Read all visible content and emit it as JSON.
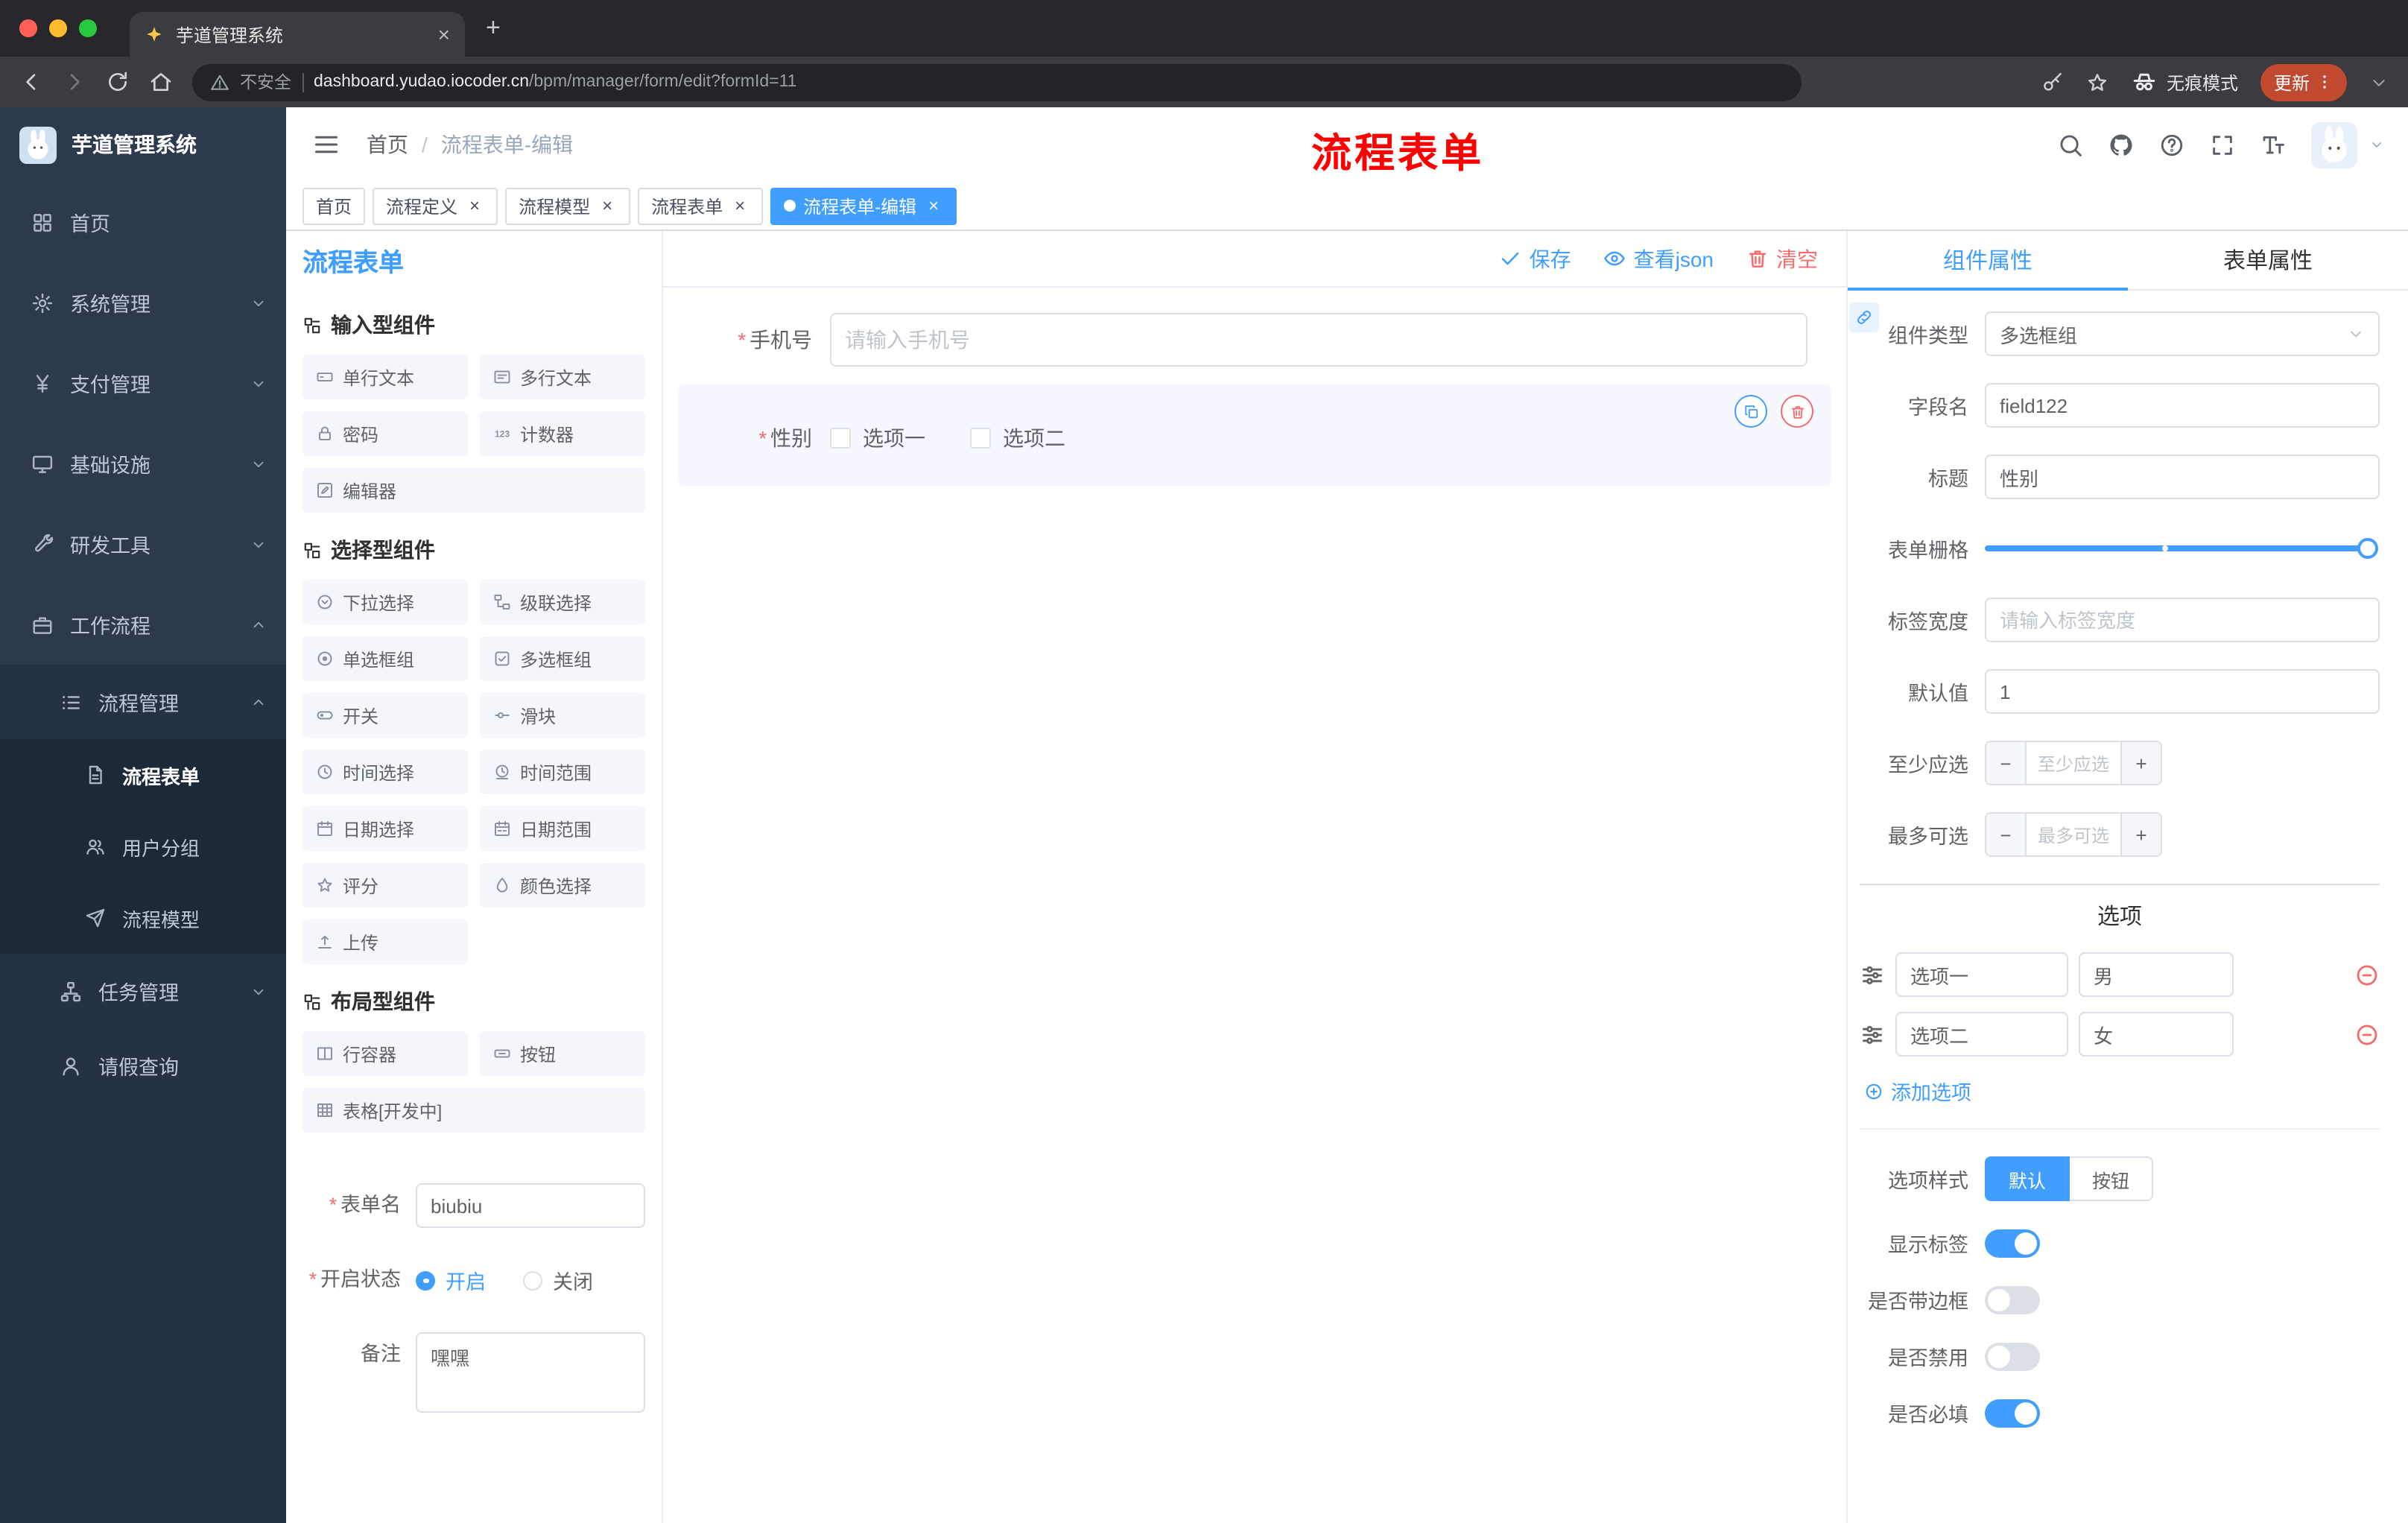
{
  "browser": {
    "tab_title": "芋道管理系统",
    "security_label": "不安全",
    "url_host": "dashboard.yudao.iocoder.cn",
    "url_path": "/bpm/manager/form/edit?formId=11",
    "incognito_label": "无痕模式",
    "update_label": "更新"
  },
  "sidebar": {
    "logo_title": "芋道管理系统",
    "items": [
      {
        "label": "首页"
      },
      {
        "label": "系统管理"
      },
      {
        "label": "支付管理"
      },
      {
        "label": "基础设施"
      },
      {
        "label": "研发工具"
      },
      {
        "label": "工作流程"
      }
    ],
    "process_group": "流程管理",
    "process_children": [
      {
        "label": "流程表单"
      },
      {
        "label": "用户分组"
      },
      {
        "label": "流程模型"
      }
    ],
    "task_group": "任务管理",
    "leave_query": "请假查询"
  },
  "header": {
    "breadcrumb_home": "首页",
    "breadcrumb_sep": "/",
    "breadcrumb_current": "流程表单-编辑",
    "annotation": "流程表单"
  },
  "tags": [
    {
      "label": "首页"
    },
    {
      "label": "流程定义"
    },
    {
      "label": "流程模型"
    },
    {
      "label": "流程表单"
    },
    {
      "label": "流程表单-编辑"
    }
  ],
  "designer": {
    "brand": "流程表单",
    "toolbar": {
      "save": "保存",
      "view_json": "查看json",
      "clear": "清空"
    },
    "palette": {
      "input_title": "输入型组件",
      "input_items": [
        "单行文本",
        "多行文本",
        "密码",
        "计数器",
        "编辑器"
      ],
      "select_title": "选择型组件",
      "select_items": [
        "下拉选择",
        "级联选择",
        "单选框组",
        "多选框组",
        "开关",
        "滑块",
        "时间选择",
        "时间范围",
        "日期选择",
        "日期范围",
        "评分",
        "颜色选择",
        "上传"
      ],
      "layout_title": "布局型组件",
      "layout_items": [
        "行容器",
        "按钮",
        "表格[开发中]"
      ]
    },
    "meta": {
      "name_label": "表单名",
      "name_value": "biubiu",
      "status_label": "开启状态",
      "status_on": "开启",
      "status_off": "关闭",
      "remark_label": "备注",
      "remark_value": "嘿嘿"
    },
    "canvas": {
      "phone_label": "手机号",
      "phone_placeholder": "请输入手机号",
      "gender_label": "性别",
      "gender_option1": "选项一",
      "gender_option2": "选项二"
    }
  },
  "props": {
    "tab_component": "组件属性",
    "tab_form": "表单属性",
    "component_type_label": "组件类型",
    "component_type_value": "多选框组",
    "field_name_label": "字段名",
    "field_name_value": "field122",
    "title_label": "标题",
    "title_value": "性别",
    "grid_label": "表单栅格",
    "label_width_label": "标签宽度",
    "label_width_placeholder": "请输入标签宽度",
    "default_label": "默认值",
    "default_value": "1",
    "min_label": "至少应选",
    "min_placeholder": "至少应选",
    "max_label": "最多可选",
    "max_placeholder": "最多可选",
    "options_title": "选项",
    "options": [
      {
        "label": "选项一",
        "value": "男"
      },
      {
        "label": "选项二",
        "value": "女"
      }
    ],
    "add_option": "添加选项",
    "style_label": "选项样式",
    "style_default": "默认",
    "style_button": "按钮",
    "show_label": "显示标签",
    "border_label": "是否带边框",
    "disabled_label": "是否禁用",
    "required_label": "是否必填"
  },
  "colors": {
    "accent": "#409eff",
    "danger": "#f56c6c",
    "annotation": "#fe0000",
    "update": "#c0492f"
  }
}
